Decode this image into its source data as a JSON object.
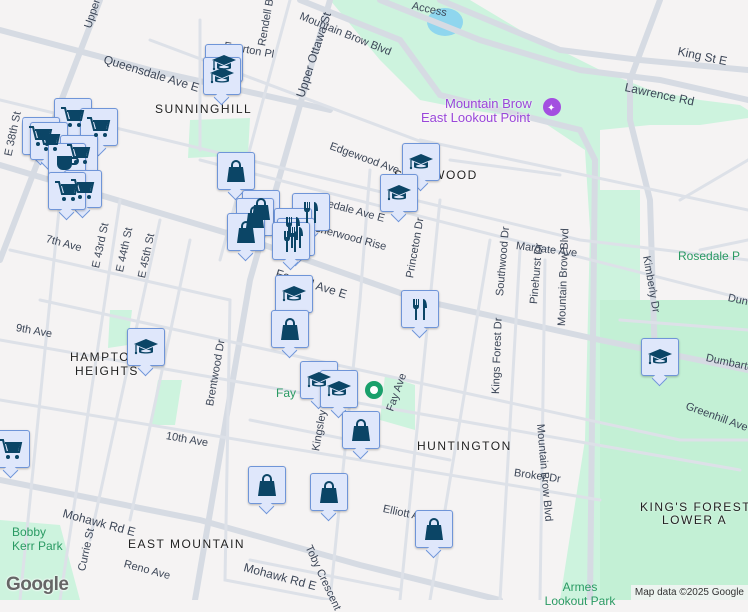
{
  "map": {
    "neighborhoods": [
      "SUNNINGHILL",
      "SHERWOOD",
      "HAMPTON",
      "HEIGHTS",
      "HUNTINGTON",
      "EAST MOUNTAIN",
      "KING'S FOREST",
      "LOWER A"
    ],
    "streets": [
      "Upper Gage Ave",
      "Queensdale Ave E",
      "Everton Pl",
      "Rendell Blvd",
      "Mountain Brow Blvd",
      "Upper Ottawa St",
      "Edgewood Ave",
      "Brucedale Ave E",
      "Sherwood Rise",
      "Fennell Ave E",
      "7th Ave",
      "E 43rd St",
      "E 44th St",
      "E 45th St",
      "Margate Ave",
      "Princeton Dr",
      "Southwood Dr",
      "Pinehurst Dr",
      "Kimberly Dr",
      "King St E",
      "Lawrence Rd",
      "Dundonald Ave",
      "Dumbarton Ave",
      "Greenhill Ave",
      "9th Ave",
      "10th Ave",
      "Brentwood Dr",
      "Kingsley Dr",
      "Fay Ave",
      "Broker Dr",
      "Kings Forest Dr",
      "Elliott Ave",
      "Toby Crescent",
      "Mohawk Rd E",
      "Currie St",
      "Reno Ave",
      "Mountain Brow Blvd",
      "E 38th St",
      "Edgewood Ave",
      "Access"
    ],
    "parks": [
      "Rosedale P",
      "Fay",
      "Bobby Kerr Park",
      "Armes Lookout Park"
    ],
    "poi": {
      "line1": "Mountain Brow",
      "line2": "East Lookout Point"
    },
    "attribution": "Map data ©2025 Google",
    "logo": "Google",
    "colors": {
      "marker_bg": "#dfe7fb",
      "marker_border": "#6f95d8",
      "icon": "#0b4566",
      "park": "#cdf3de",
      "road": "#d5dae2",
      "poi": "#9a46d9"
    }
  },
  "markers": [
    "school",
    "shopping",
    "restaurant",
    "grocery",
    "cafe"
  ]
}
